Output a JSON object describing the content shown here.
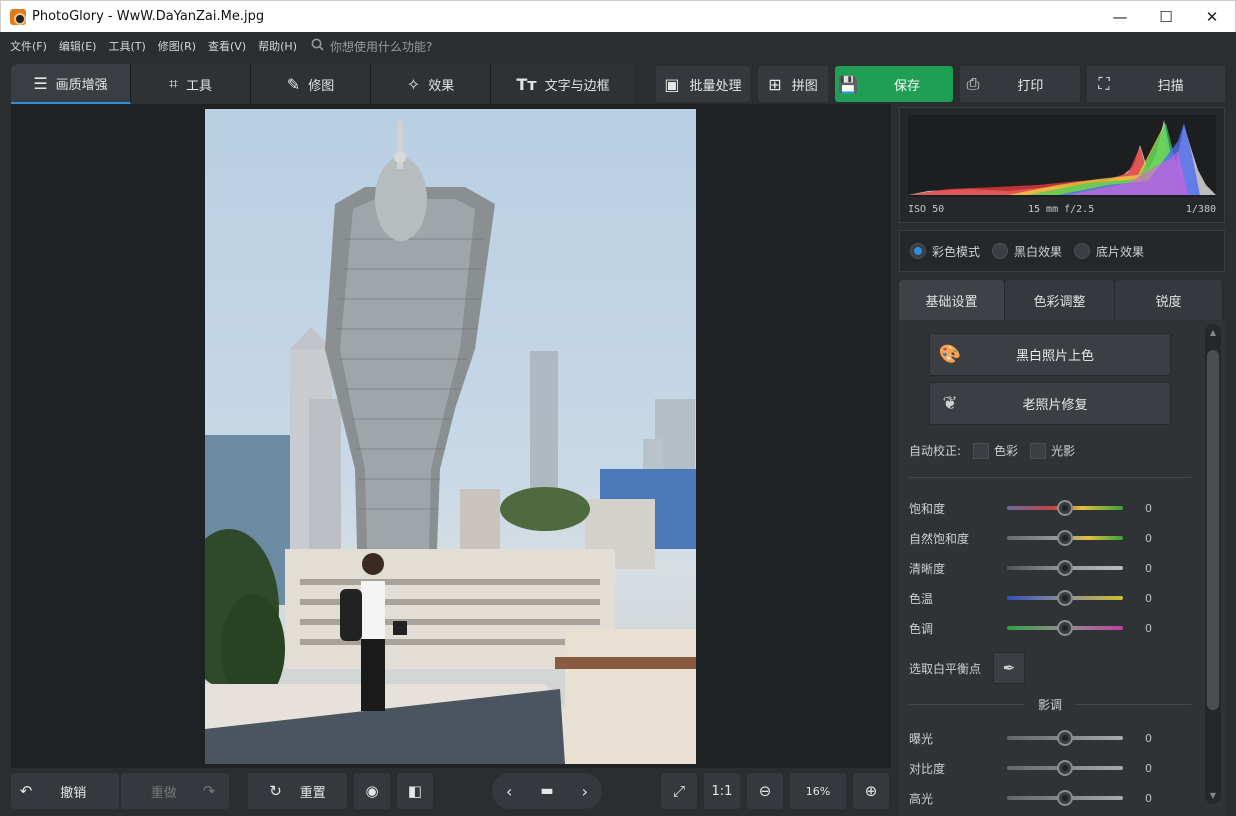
{
  "window": {
    "title": "PhotoGlory - WwW.DaYanZai.Me.jpg",
    "minimize": "—",
    "maximize": "☐",
    "close": "✕"
  },
  "menu": {
    "items": [
      "文件(F)",
      "编辑(E)",
      "工具(T)",
      "修图(R)",
      "查看(V)",
      "帮助(H)"
    ],
    "search_placeholder": "你想使用什么功能?"
  },
  "toolbar": {
    "tabs": [
      {
        "label": "画质增强",
        "icon": "sliders-icon"
      },
      {
        "label": "工具",
        "icon": "crop-icon"
      },
      {
        "label": "修图",
        "icon": "brush-icon"
      },
      {
        "label": "效果",
        "icon": "magic-wand-icon"
      },
      {
        "label": "文字与边框",
        "icon": "text-icon"
      }
    ],
    "active_tab": "画质增强",
    "batch": "批量处理",
    "collage": "拼图",
    "save": "保存",
    "print": "打印",
    "scan": "扫描"
  },
  "bottom": {
    "undo": "撤销",
    "redo": "重做",
    "reset": "重置",
    "actual_size": "1:1",
    "zoom": "16%"
  },
  "histogram": {
    "iso": "ISO 50",
    "lens": "15 mm  f/2.5",
    "shutter": "1/380"
  },
  "modes": {
    "color": "彩色模式",
    "bw": "黑白效果",
    "negative": "底片效果",
    "selected": "彩色模式"
  },
  "panel_tabs": [
    "基础设置",
    "色彩调整",
    "锐度"
  ],
  "panel": {
    "colorize_bw": "黑白照片上色",
    "restore_old": "老照片修复",
    "auto_correct": "自动校正:",
    "auto_color": "色彩",
    "auto_light": "光影",
    "white_balance": "选取白平衡点",
    "section_tone": "影调"
  },
  "sliders": [
    {
      "name": "饱和度",
      "value": "0",
      "gradient": [
        "#5a5a8a",
        "#c84040",
        "#3aa03a"
      ]
    },
    {
      "name": "自然饱和度",
      "value": "0",
      "gradient": [
        "#6a6a6a",
        "#d0a040",
        "#3aa03a"
      ]
    },
    {
      "name": "清晰度",
      "value": "0",
      "gradient": [
        "#555555",
        "#888888",
        "#bbbbbb"
      ]
    },
    {
      "name": "色温",
      "value": "0",
      "gradient": [
        "#3050c0",
        "#909090",
        "#d0c030"
      ]
    },
    {
      "name": "色调",
      "value": "0",
      "gradient": [
        "#30a040",
        "#909090",
        "#c040a0"
      ]
    }
  ],
  "tone_sliders": [
    {
      "name": "曝光",
      "value": "0"
    },
    {
      "name": "对比度",
      "value": "0"
    },
    {
      "name": "高光",
      "value": "0"
    }
  ]
}
